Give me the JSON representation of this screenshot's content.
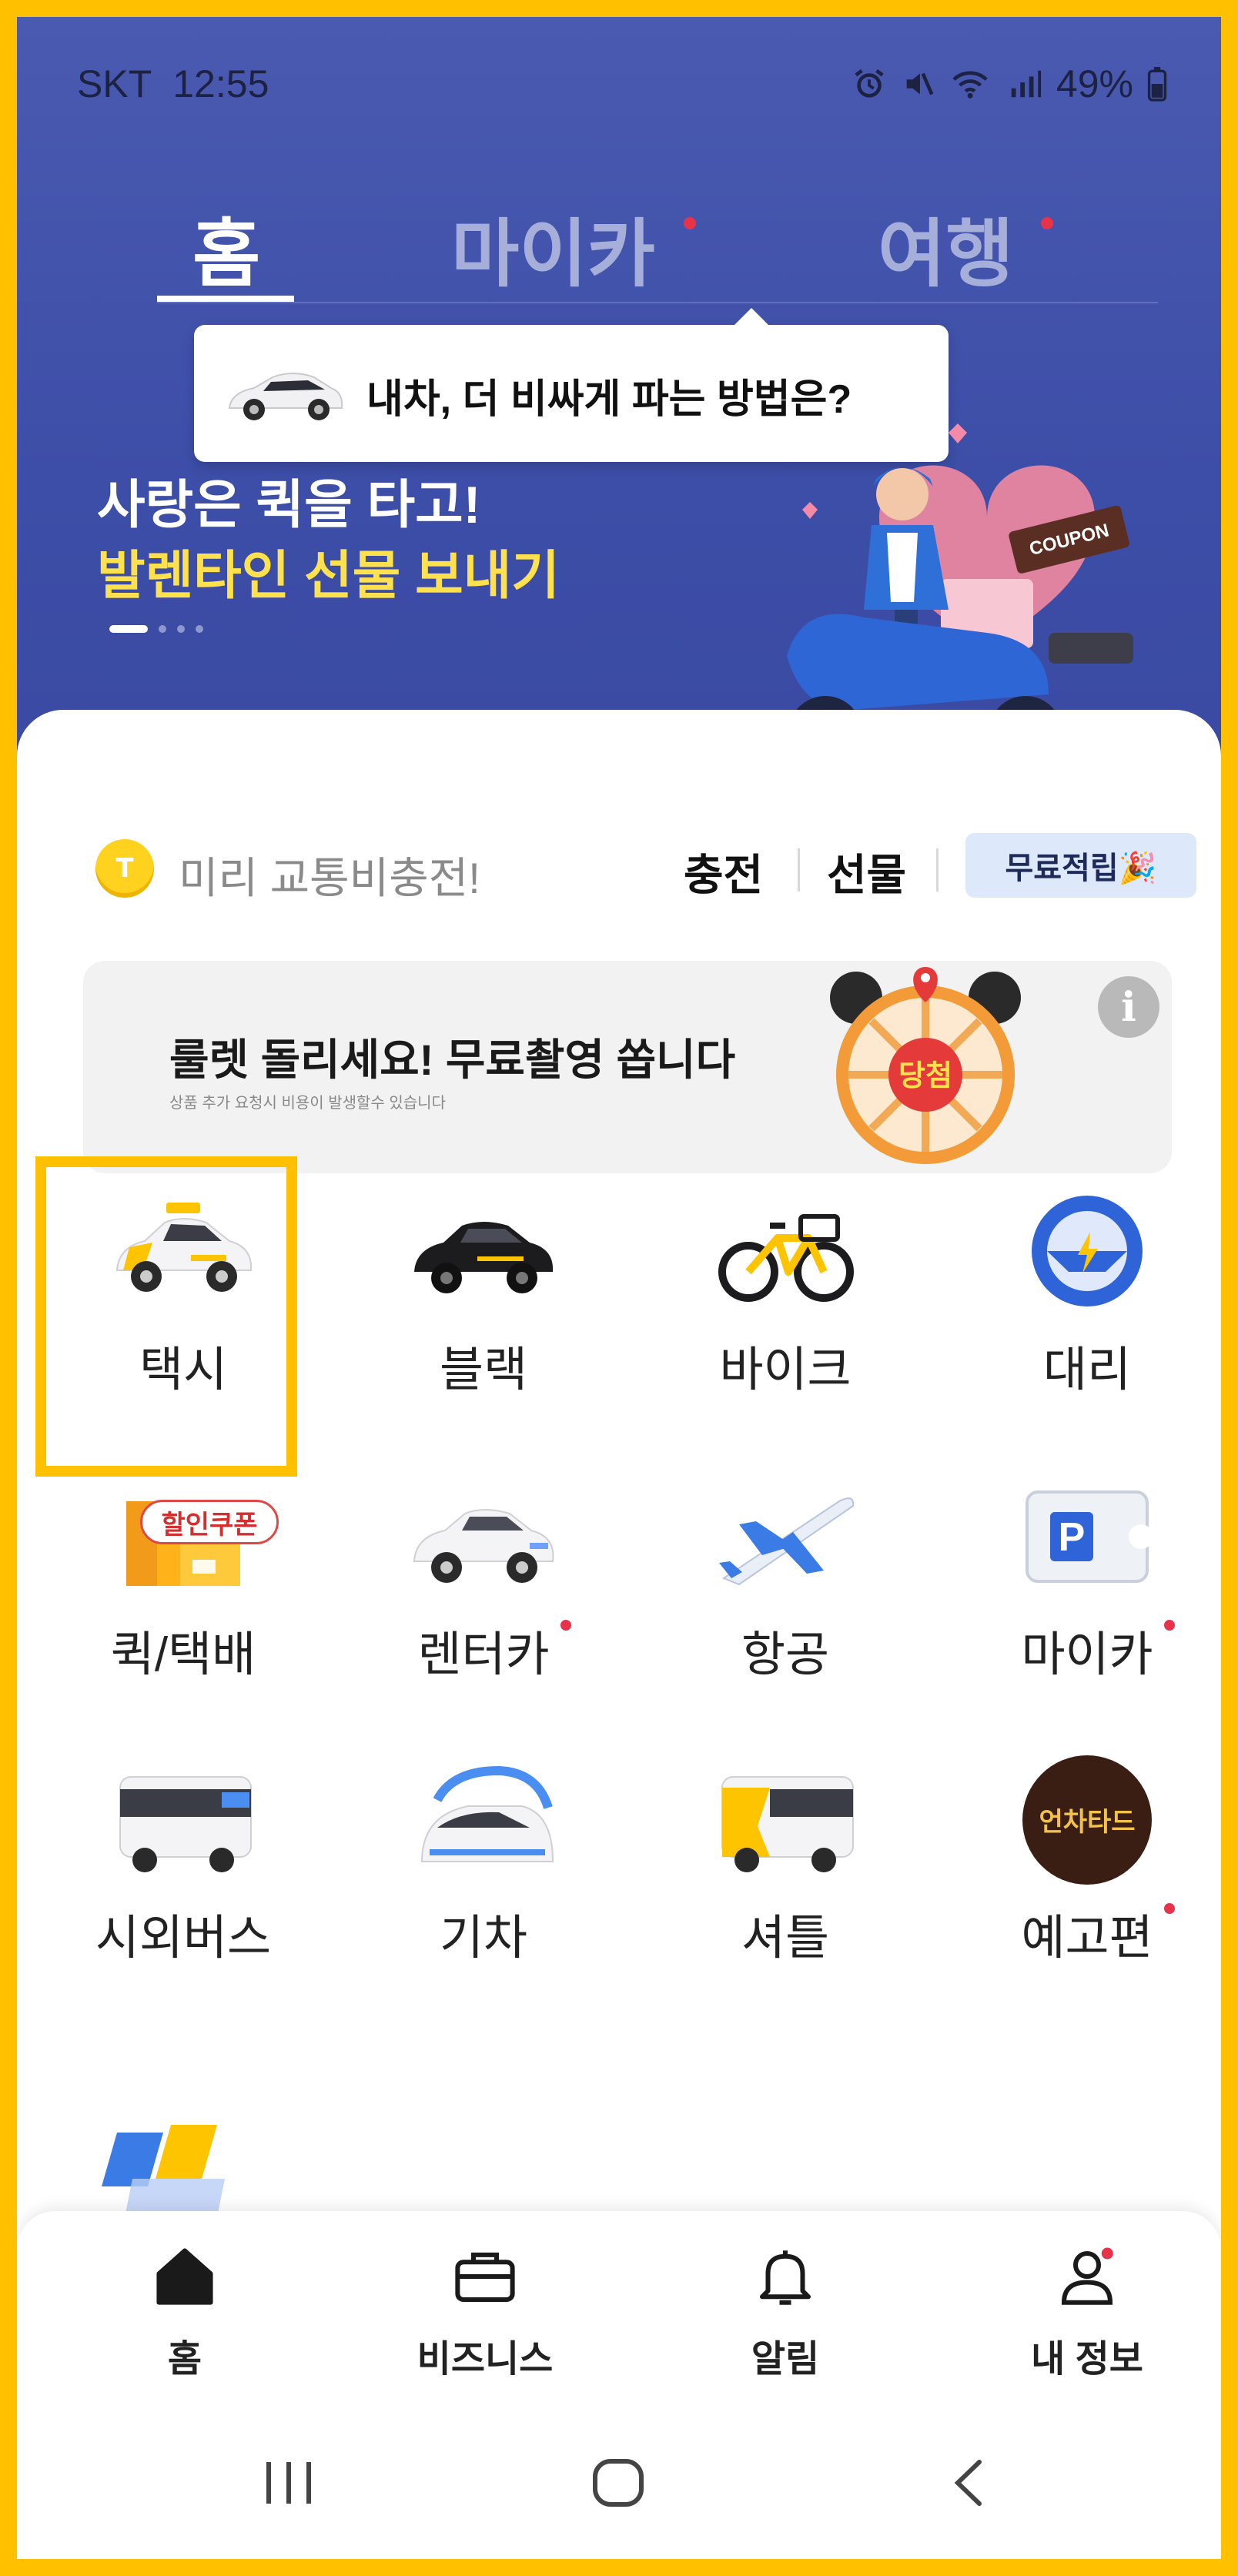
{
  "status_bar": {
    "carrier": "SKT",
    "time": "12:55",
    "battery": "49%"
  },
  "tabs": [
    {
      "label": "홈",
      "active": true
    },
    {
      "label": "마이카",
      "badge": true
    },
    {
      "label": "여행",
      "badge": true
    }
  ],
  "tooltip": {
    "text": "내차, 더 비싸게 파는 방법은?"
  },
  "banner": {
    "line1": "사랑은 퀵을 타고!",
    "line2": "발렌타인 선물 보내기",
    "coupon_sign": "COUPON"
  },
  "charge": {
    "coin_label": "T",
    "text": "미리 교통비충전!",
    "charge_label": "충전",
    "gift_label": "선물",
    "free_label": "무료적립🎉"
  },
  "ad": {
    "title": "룰렛 돌리세요! 무료촬영 쏩니다",
    "subtitle": "상품 추가 요청시 비용이 발생할수 있습니다",
    "win_label": "당첨",
    "info": "i"
  },
  "services": [
    {
      "label": "택시",
      "icon": "taxi-icon"
    },
    {
      "label": "블랙",
      "icon": "black-car-icon"
    },
    {
      "label": "바이크",
      "icon": "bike-icon"
    },
    {
      "label": "대리",
      "icon": "steering-wheel-icon"
    },
    {
      "label": "퀵/택배",
      "icon": "box-icon",
      "tag": "할인쿠폰"
    },
    {
      "label": "렌터카",
      "icon": "rental-car-icon",
      "badge": true
    },
    {
      "label": "항공",
      "icon": "airplane-icon"
    },
    {
      "label": "마이카",
      "icon": "parking-icon",
      "badge": true
    },
    {
      "label": "시외버스",
      "icon": "bus-icon"
    },
    {
      "label": "기차",
      "icon": "train-icon"
    },
    {
      "label": "셔틀",
      "icon": "shuttle-icon"
    },
    {
      "label": "예고편",
      "icon": "trailer-icon",
      "badge": true,
      "badge_text": "언차타드"
    }
  ],
  "bottom_nav": [
    {
      "label": "홈",
      "icon": "home-icon"
    },
    {
      "label": "비즈니스",
      "icon": "briefcase-icon"
    },
    {
      "label": "알림",
      "icon": "bell-icon"
    },
    {
      "label": "내 정보",
      "icon": "person-icon",
      "badge": true
    }
  ],
  "colors": {
    "hero": "#3d4ea8",
    "accent_yellow": "#ffe14d",
    "badge_red": "#e6334a",
    "frame_highlight": "#FFC000"
  }
}
